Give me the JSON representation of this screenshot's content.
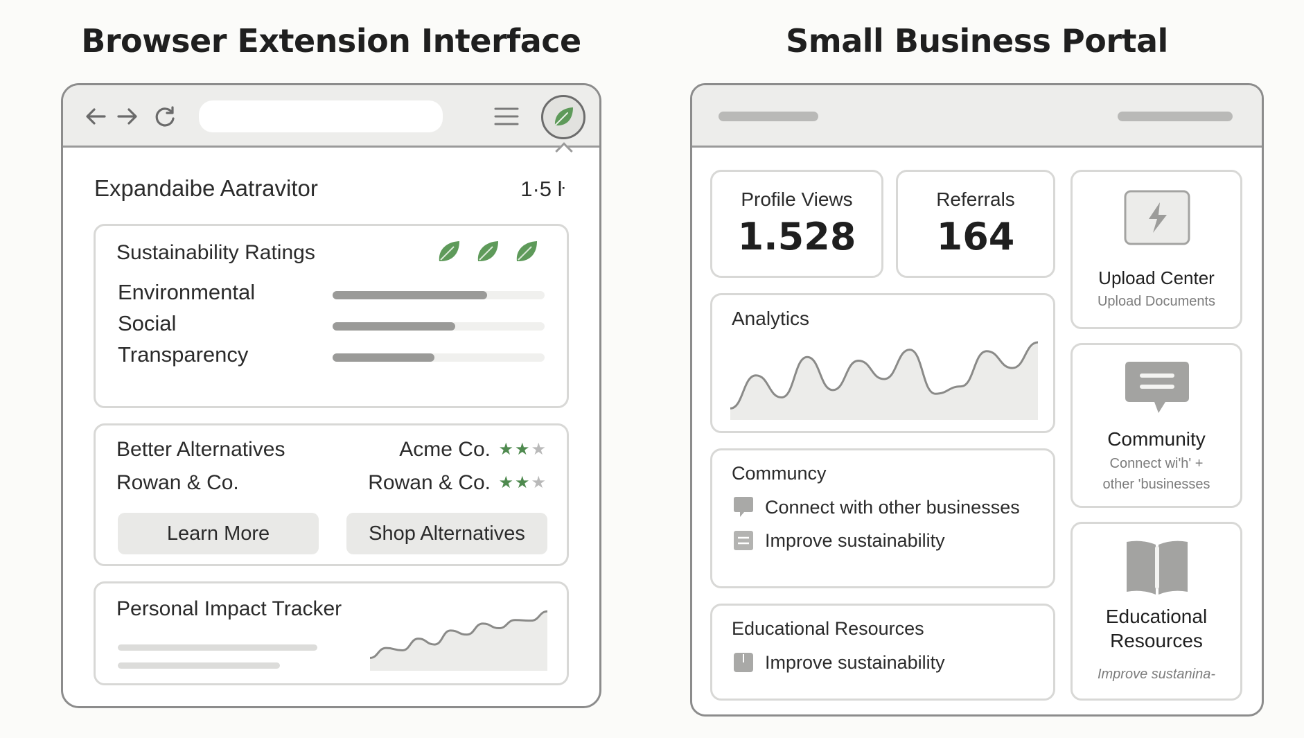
{
  "headings": {
    "left": "Browser Extension Interface",
    "right": "Small Business Portal"
  },
  "extension": {
    "title": "Expandaibe  Aatravitor",
    "meta": "1·5 ŀ",
    "ratings": {
      "title": "Sustainability Ratings",
      "leaf_count": 3,
      "items": [
        {
          "label": "Environmental",
          "fill": 0.73
        },
        {
          "label": "Social",
          "fill": 0.58
        },
        {
          "label": "Transparency",
          "fill": 0.48
        }
      ]
    },
    "alternatives": {
      "title": "Better Alternatives",
      "left_item": "Rowan & Co.",
      "right_items": [
        {
          "name": "Acme Co.",
          "stars": 2,
          "max_stars": 3
        },
        {
          "name": "Rowan & Co.",
          "stars": 2,
          "max_stars": 3
        }
      ],
      "learn_more": "Learn More",
      "shop": "Shop Alternatives"
    },
    "impact": {
      "title": "Personal Impact Tracker",
      "trend": [
        0.15,
        0.32,
        0.28,
        0.48,
        0.38,
        0.62,
        0.55,
        0.74,
        0.66,
        0.8,
        0.79,
        0.95
      ]
    }
  },
  "portal": {
    "profile_views": {
      "label": "Profile Views",
      "value": "1.528"
    },
    "referrals": {
      "label": "Referrals",
      "value": "164"
    },
    "analytics": {
      "title": "Analytics",
      "trend": [
        0.1,
        0.55,
        0.25,
        0.8,
        0.35,
        0.75,
        0.5,
        0.9,
        0.3,
        0.4,
        0.88,
        0.65,
        1.0
      ]
    },
    "community": {
      "title": "Communcy",
      "items": [
        "Connect with other businesses",
        "Improve sustainability"
      ]
    },
    "education": {
      "title": "Educational Resources",
      "items": [
        "Improve sustainability"
      ]
    },
    "upload_center": {
      "title": "Upload Center",
      "subtitle": "Upload Documents"
    },
    "community_side": {
      "title": "Community",
      "subtitle_line1": "Connect wi'h' +",
      "subtitle_line2": "other 'businesses"
    },
    "education_side": {
      "title_line1": "Educational",
      "title_line2": "Resources",
      "subtitle": "Improve sustanina-"
    }
  },
  "colors": {
    "leaf_green": "#5e9a5a",
    "star_green": "#4f8a4f",
    "bar_fill": "#9a9a98",
    "icon_gray": "#a9a9a7"
  }
}
